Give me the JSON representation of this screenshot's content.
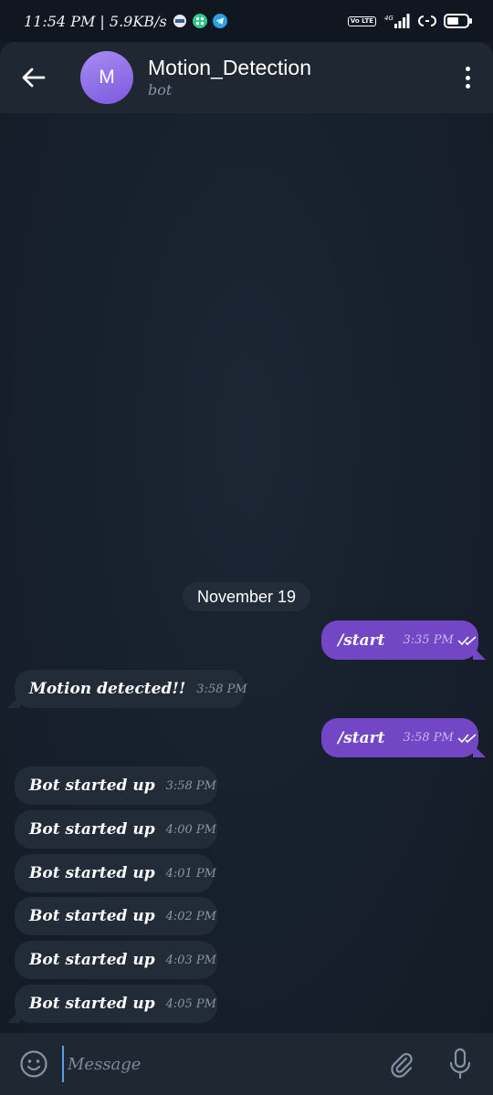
{
  "status_bar": {
    "time_speed": "11:54 PM | 5.9KB/s",
    "network": "4G",
    "volte": "Vo LTE"
  },
  "header": {
    "avatar_letter": "M",
    "title": "Motion_Detection",
    "subtitle": "bot"
  },
  "date_chip": "November 19",
  "messages": [
    {
      "direction": "out",
      "text": "/start",
      "time": "3:35 PM",
      "read": true
    },
    {
      "direction": "in",
      "text": "Motion detected!!",
      "time": "3:58 PM"
    },
    {
      "direction": "out",
      "text": "/start",
      "time": "3:58 PM",
      "read": true
    },
    {
      "direction": "in",
      "text": "Bot started up",
      "time": "3:58 PM"
    },
    {
      "direction": "in",
      "text": "Bot started up",
      "time": "4:00 PM"
    },
    {
      "direction": "in",
      "text": "Bot started up",
      "time": "4:01 PM"
    },
    {
      "direction": "in",
      "text": "Bot started up",
      "time": "4:02 PM"
    },
    {
      "direction": "in",
      "text": "Bot started up",
      "time": "4:03 PM"
    },
    {
      "direction": "in",
      "text": "Bot started up",
      "time": "4:05 PM"
    }
  ],
  "input": {
    "placeholder": "Message"
  },
  "colors": {
    "outgoing_bubble": "#7246c4",
    "incoming_bubble": "#222b38",
    "header": "#1f2733",
    "background": "#151b25"
  }
}
